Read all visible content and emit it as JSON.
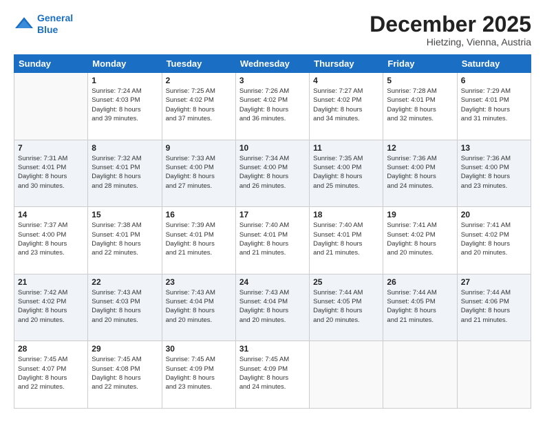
{
  "header": {
    "logo_line1": "General",
    "logo_line2": "Blue",
    "month": "December 2025",
    "location": "Hietzing, Vienna, Austria"
  },
  "weekdays": [
    "Sunday",
    "Monday",
    "Tuesday",
    "Wednesday",
    "Thursday",
    "Friday",
    "Saturday"
  ],
  "weeks": [
    [
      {
        "day": "",
        "info": ""
      },
      {
        "day": "1",
        "info": "Sunrise: 7:24 AM\nSunset: 4:03 PM\nDaylight: 8 hours\nand 39 minutes."
      },
      {
        "day": "2",
        "info": "Sunrise: 7:25 AM\nSunset: 4:02 PM\nDaylight: 8 hours\nand 37 minutes."
      },
      {
        "day": "3",
        "info": "Sunrise: 7:26 AM\nSunset: 4:02 PM\nDaylight: 8 hours\nand 36 minutes."
      },
      {
        "day": "4",
        "info": "Sunrise: 7:27 AM\nSunset: 4:02 PM\nDaylight: 8 hours\nand 34 minutes."
      },
      {
        "day": "5",
        "info": "Sunrise: 7:28 AM\nSunset: 4:01 PM\nDaylight: 8 hours\nand 32 minutes."
      },
      {
        "day": "6",
        "info": "Sunrise: 7:29 AM\nSunset: 4:01 PM\nDaylight: 8 hours\nand 31 minutes."
      }
    ],
    [
      {
        "day": "7",
        "info": "Sunrise: 7:31 AM\nSunset: 4:01 PM\nDaylight: 8 hours\nand 30 minutes."
      },
      {
        "day": "8",
        "info": "Sunrise: 7:32 AM\nSunset: 4:01 PM\nDaylight: 8 hours\nand 28 minutes."
      },
      {
        "day": "9",
        "info": "Sunrise: 7:33 AM\nSunset: 4:00 PM\nDaylight: 8 hours\nand 27 minutes."
      },
      {
        "day": "10",
        "info": "Sunrise: 7:34 AM\nSunset: 4:00 PM\nDaylight: 8 hours\nand 26 minutes."
      },
      {
        "day": "11",
        "info": "Sunrise: 7:35 AM\nSunset: 4:00 PM\nDaylight: 8 hours\nand 25 minutes."
      },
      {
        "day": "12",
        "info": "Sunrise: 7:36 AM\nSunset: 4:00 PM\nDaylight: 8 hours\nand 24 minutes."
      },
      {
        "day": "13",
        "info": "Sunrise: 7:36 AM\nSunset: 4:00 PM\nDaylight: 8 hours\nand 23 minutes."
      }
    ],
    [
      {
        "day": "14",
        "info": "Sunrise: 7:37 AM\nSunset: 4:00 PM\nDaylight: 8 hours\nand 23 minutes."
      },
      {
        "day": "15",
        "info": "Sunrise: 7:38 AM\nSunset: 4:01 PM\nDaylight: 8 hours\nand 22 minutes."
      },
      {
        "day": "16",
        "info": "Sunrise: 7:39 AM\nSunset: 4:01 PM\nDaylight: 8 hours\nand 21 minutes."
      },
      {
        "day": "17",
        "info": "Sunrise: 7:40 AM\nSunset: 4:01 PM\nDaylight: 8 hours\nand 21 minutes."
      },
      {
        "day": "18",
        "info": "Sunrise: 7:40 AM\nSunset: 4:01 PM\nDaylight: 8 hours\nand 21 minutes."
      },
      {
        "day": "19",
        "info": "Sunrise: 7:41 AM\nSunset: 4:02 PM\nDaylight: 8 hours\nand 20 minutes."
      },
      {
        "day": "20",
        "info": "Sunrise: 7:41 AM\nSunset: 4:02 PM\nDaylight: 8 hours\nand 20 minutes."
      }
    ],
    [
      {
        "day": "21",
        "info": "Sunrise: 7:42 AM\nSunset: 4:02 PM\nDaylight: 8 hours\nand 20 minutes."
      },
      {
        "day": "22",
        "info": "Sunrise: 7:43 AM\nSunset: 4:03 PM\nDaylight: 8 hours\nand 20 minutes."
      },
      {
        "day": "23",
        "info": "Sunrise: 7:43 AM\nSunset: 4:04 PM\nDaylight: 8 hours\nand 20 minutes."
      },
      {
        "day": "24",
        "info": "Sunrise: 7:43 AM\nSunset: 4:04 PM\nDaylight: 8 hours\nand 20 minutes."
      },
      {
        "day": "25",
        "info": "Sunrise: 7:44 AM\nSunset: 4:05 PM\nDaylight: 8 hours\nand 20 minutes."
      },
      {
        "day": "26",
        "info": "Sunrise: 7:44 AM\nSunset: 4:05 PM\nDaylight: 8 hours\nand 21 minutes."
      },
      {
        "day": "27",
        "info": "Sunrise: 7:44 AM\nSunset: 4:06 PM\nDaylight: 8 hours\nand 21 minutes."
      }
    ],
    [
      {
        "day": "28",
        "info": "Sunrise: 7:45 AM\nSunset: 4:07 PM\nDaylight: 8 hours\nand 22 minutes."
      },
      {
        "day": "29",
        "info": "Sunrise: 7:45 AM\nSunset: 4:08 PM\nDaylight: 8 hours\nand 22 minutes."
      },
      {
        "day": "30",
        "info": "Sunrise: 7:45 AM\nSunset: 4:09 PM\nDaylight: 8 hours\nand 23 minutes."
      },
      {
        "day": "31",
        "info": "Sunrise: 7:45 AM\nSunset: 4:09 PM\nDaylight: 8 hours\nand 24 minutes."
      },
      {
        "day": "",
        "info": ""
      },
      {
        "day": "",
        "info": ""
      },
      {
        "day": "",
        "info": ""
      }
    ]
  ]
}
